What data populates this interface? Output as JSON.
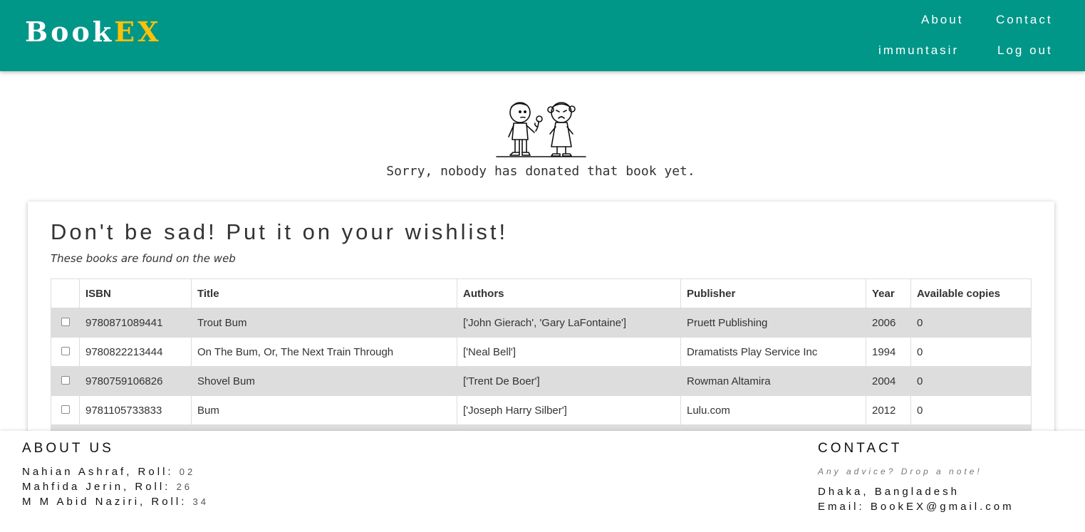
{
  "header": {
    "brand_main": "Book",
    "brand_accent": "EX",
    "nav": {
      "about": "About",
      "contact": "Contact",
      "user": "immuntasir",
      "logout": "Log out"
    }
  },
  "notice": {
    "illustration": "sad-kids-icon",
    "message": "Sorry, nobody has donated that book yet."
  },
  "wishlist": {
    "title": "Don't be sad! Put it on your wishlist!",
    "subtitle": "These books are found on the web",
    "columns": [
      "",
      "ISBN",
      "Title",
      "Authors",
      "Publisher",
      "Year",
      "Available copies"
    ],
    "rows": [
      {
        "isbn": "9780871089441",
        "title": "Trout Bum",
        "authors": "['John Gierach', 'Gary LaFontaine']",
        "publisher": "Pruett Publishing",
        "year": "2006",
        "copies": "0",
        "checked": false
      },
      {
        "isbn": "9780822213444",
        "title": "On The Bum, Or, The Next Train Through",
        "authors": "['Neal Bell']",
        "publisher": "Dramatists Play Service Inc",
        "year": "1994",
        "copies": "0",
        "checked": false
      },
      {
        "isbn": "9780759106826",
        "title": "Shovel Bum",
        "authors": "['Trent De Boer']",
        "publisher": "Rowman Altamira",
        "year": "2004",
        "copies": "0",
        "checked": false
      },
      {
        "isbn": "9781105733833",
        "title": "Bum",
        "authors": "['Joseph Harry Silber']",
        "publisher": "Lulu.com",
        "year": "2012",
        "copies": "0",
        "checked": false
      }
    ]
  },
  "footer": {
    "about": {
      "heading": "ABOUT US",
      "members": [
        {
          "name": "Nahian Ashraf, Roll:",
          "roll": "02"
        },
        {
          "name": "Mahfida Jerin, Roll:",
          "roll": "26"
        },
        {
          "name": "M M Abid Naziri, Roll:",
          "roll": "34"
        }
      ]
    },
    "contact": {
      "heading": "CONTACT",
      "note": "Any advice? Drop a note!",
      "location": "Dhaka, Bangladesh",
      "email": "Email: BookEX@gmail.com"
    }
  },
  "colors": {
    "primary": "#009688",
    "accent": "#ffc107",
    "stripe": "#dddddd"
  }
}
